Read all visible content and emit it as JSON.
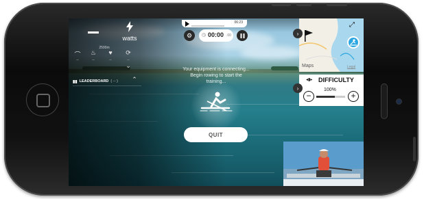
{
  "hud": {
    "primary_value": "–",
    "watts_label": "watts",
    "metrics_caption": "2500m"
  },
  "player": {
    "progress_time": "06:23",
    "timer": "00:00",
    "timer_fraction": ".00"
  },
  "leaderboard": {
    "label": "LEADERBOARD",
    "suffix": "( -- )"
  },
  "overlay": {
    "message_line1": "Your equipment is connecting...",
    "message_line2": "Begin rowing to start the",
    "message_line3": "training...",
    "quit_label": "QUIT"
  },
  "map": {
    "provider_label": "Maps",
    "legal_label": "Legal"
  },
  "difficulty": {
    "title": "DIFFICULTY",
    "value": "100%",
    "level_fraction": 0.65
  },
  "icons": {
    "bolt": "lightning-bolt-icon",
    "settings": "gear-icon",
    "pause": "pause-icon",
    "play": "play-icon",
    "flag": "flag-icon",
    "expand": "expand-icon",
    "rower": "rowing-boat-icon"
  },
  "colors": {
    "accent_blue": "#2aa6e0",
    "map_water": "#a9d7ee",
    "map_land": "#f2efe6"
  }
}
